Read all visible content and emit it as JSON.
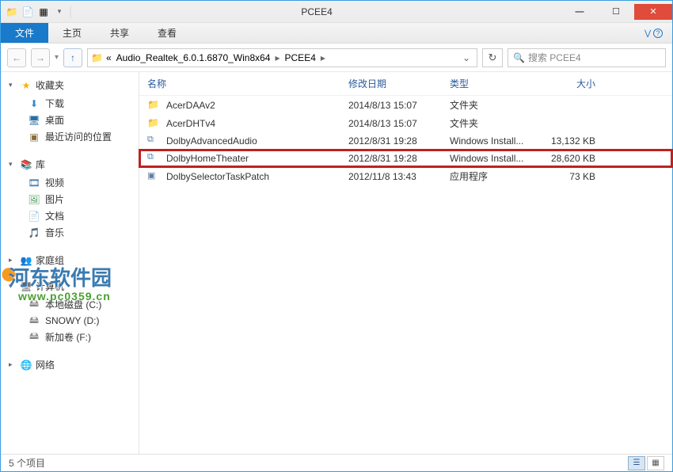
{
  "window": {
    "title": "PCEE4"
  },
  "ribbon": {
    "file": "文件",
    "tabs": [
      "主页",
      "共享",
      "查看"
    ]
  },
  "address": {
    "segments": [
      "Audio_Realtek_6.0.1.6870_Win8x64",
      "PCEE4"
    ],
    "prefix": "«"
  },
  "search": {
    "placeholder": "搜索 PCEE4"
  },
  "nav": {
    "favorites": {
      "label": "收藏夹",
      "items": [
        {
          "label": "下载"
        },
        {
          "label": "桌面"
        },
        {
          "label": "最近访问的位置"
        }
      ]
    },
    "libraries": {
      "label": "库",
      "items": [
        {
          "label": "视频"
        },
        {
          "label": "图片"
        },
        {
          "label": "文档"
        },
        {
          "label": "音乐"
        }
      ]
    },
    "homegroup": {
      "label": "家庭组"
    },
    "computer": {
      "label": "计算机",
      "items": [
        {
          "label": "本地磁盘 (C:)"
        },
        {
          "label": "SNOWY (D:)"
        },
        {
          "label": "新加卷 (F:)"
        }
      ]
    },
    "network": {
      "label": "网络"
    }
  },
  "columns": {
    "name": "名称",
    "date": "修改日期",
    "type": "类型",
    "size": "大小"
  },
  "files": [
    {
      "icon": "folder",
      "name": "AcerDAAv2",
      "date": "2014/8/13 15:07",
      "type": "文件夹",
      "size": ""
    },
    {
      "icon": "folder",
      "name": "AcerDHTv4",
      "date": "2014/8/13 15:07",
      "type": "文件夹",
      "size": ""
    },
    {
      "icon": "msi",
      "name": "DolbyAdvancedAudio",
      "date": "2012/8/31 19:28",
      "type": "Windows Install...",
      "size": "13,132 KB"
    },
    {
      "icon": "msi",
      "name": "DolbyHomeTheater",
      "date": "2012/8/31 19:28",
      "type": "Windows Install...",
      "size": "28,620 KB",
      "highlight": true
    },
    {
      "icon": "exe",
      "name": "DolbySelectorTaskPatch",
      "date": "2012/11/8 13:43",
      "type": "应用程序",
      "size": "73 KB"
    }
  ],
  "status": {
    "text": "5 个项目"
  },
  "watermark": {
    "line1": "河东软件园",
    "line2": "www.pc0359.cn"
  }
}
